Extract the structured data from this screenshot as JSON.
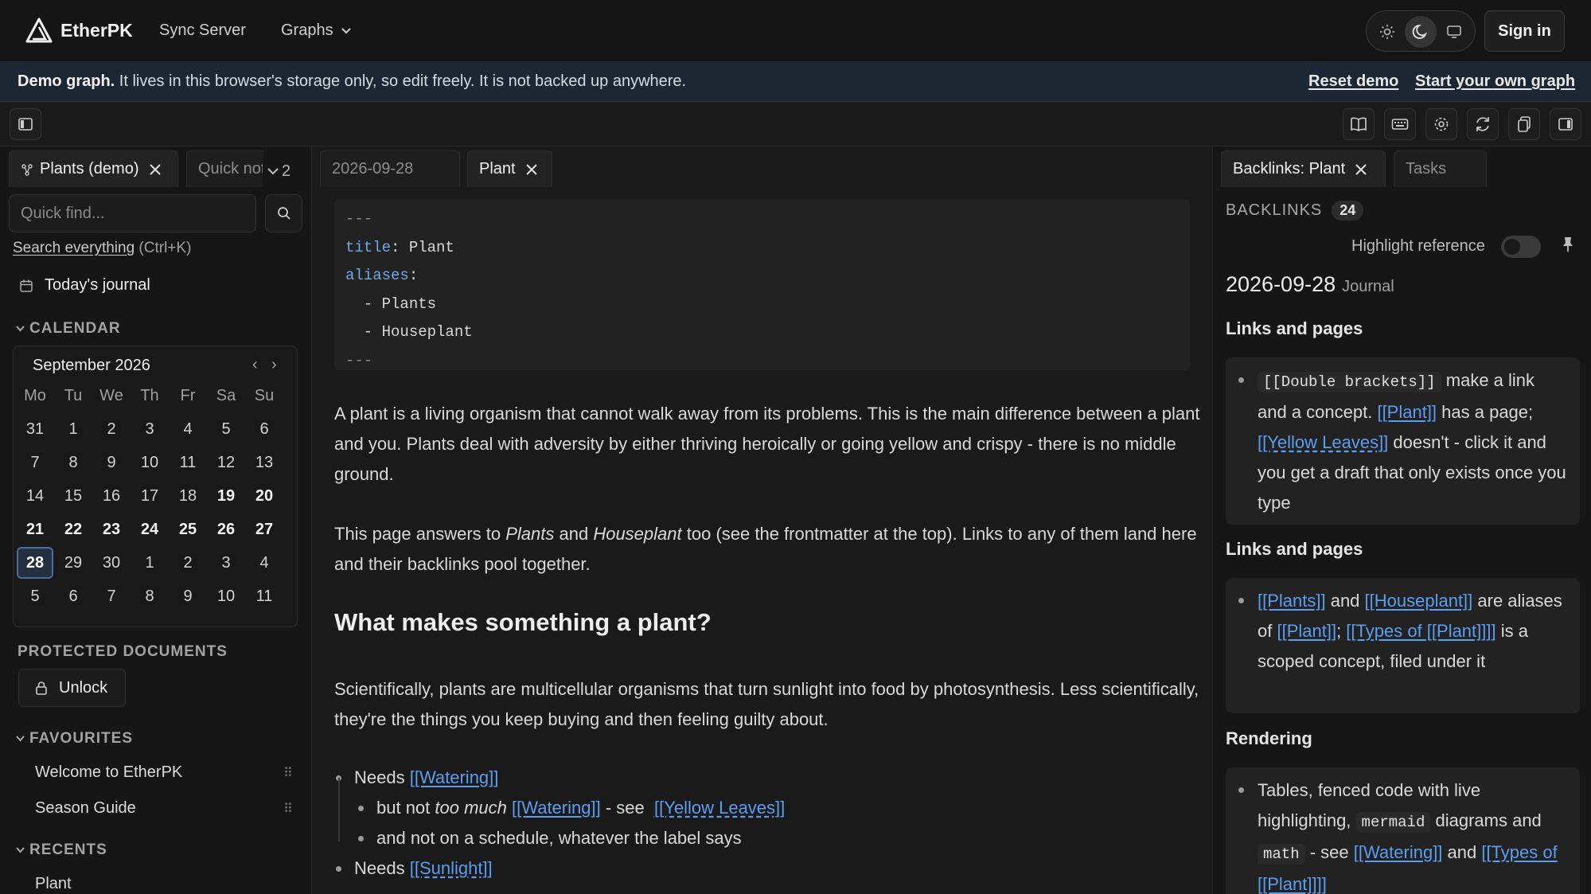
{
  "app": {
    "name": "EtherPK",
    "nav": {
      "sync": "Sync Server",
      "graphs": "Graphs"
    },
    "signin": "Sign in"
  },
  "banner": {
    "bold": "Demo graph.",
    "text": " It lives in this browser's storage only, so edit freely. It is not backed up anywhere.",
    "reset": "Reset demo",
    "start": "Start your own graph"
  },
  "left": {
    "tabs": {
      "plants": "Plants (demo)",
      "quick": "Quick notes",
      "more_count": "2"
    },
    "quickfind_placeholder": "Quick find...",
    "search_everything": "Search everything",
    "search_shortcut": " (Ctrl+K)",
    "todays_journal": "Today's journal",
    "calendar_label": "CALENDAR",
    "calendar": {
      "month": "September 2026",
      "weekdays": [
        "Mo",
        "Tu",
        "We",
        "Th",
        "Fr",
        "Sa",
        "Su"
      ],
      "weeks": [
        [
          "31",
          "1",
          "2",
          "3",
          "4",
          "5",
          "6"
        ],
        [
          "7",
          "8",
          "9",
          "10",
          "11",
          "12",
          "13"
        ],
        [
          "14",
          "15",
          "16",
          "17",
          "18",
          "19",
          "20"
        ],
        [
          "21",
          "22",
          "23",
          "24",
          "25",
          "26",
          "27"
        ],
        [
          "28",
          "29",
          "30",
          "1",
          "2",
          "3",
          "4"
        ],
        [
          "5",
          "6",
          "7",
          "8",
          "9",
          "10",
          "11"
        ]
      ],
      "today": "28"
    },
    "protected_label": "PROTECTED DOCUMENTS",
    "unlock": "Unlock",
    "favourites_label": "FAVOURITES",
    "favourites": [
      "Welcome to EtherPK",
      "Season Guide"
    ],
    "recents_label": "RECENTS",
    "recents": [
      "Plant"
    ]
  },
  "center": {
    "tabs": {
      "journal": "2026-09-28",
      "plant": "Plant"
    },
    "frontmatter": {
      "dash": "---",
      "title_key": "title",
      "title_val": "Plant",
      "aliases_key": "aliases",
      "aliases": [
        "Plants",
        "Houseplant"
      ]
    },
    "p1": "A plant is a living organism that cannot walk away from its problems. This is the main difference between a plant and you. Plants deal with adversity by either thriving heroically or going yellow and crispy - there is no middle ground.",
    "p2": {
      "a": "This page answers to ",
      "b": "Plants",
      "c": " and ",
      "d": "Houseplant",
      "e": " too (see the frontmatter at the top). Links to any of them land here and their backlinks pool together."
    },
    "heading": "What makes something a plant?",
    "p3": "Scientifically, plants are multicellular organisms that turn sunlight into food by photosynthesis. Less scientifically, they're the things you keep buying and then feeling guilty about.",
    "bullets": {
      "b1_pre": "Needs ",
      "b1_link": "[[Watering]]",
      "b2_pre": "but not ",
      "b2_em": "too much",
      "b2_link1": "[[Watering]]",
      "b2_mid": " - see ",
      "b2_link2": "[[Yellow Leaves]]",
      "b3": "and not on a schedule, whatever the label says",
      "b4_pre": "Needs ",
      "b4_link": "[[Sunlight]]"
    }
  },
  "right": {
    "tabs": {
      "backlinks": "Backlinks: Plant",
      "tasks": "Tasks"
    },
    "backlinks_label": "BACKLINKS",
    "backlinks_count": "24",
    "highlight_label": "Highlight reference",
    "date": "2026-09-28",
    "date_tag": "Journal",
    "sec1": "Links and pages",
    "card1": {
      "code": "[[Double brackets]]",
      "t1": " make a link and a concept. ",
      "l1": "[[Plant]]",
      "t2": " has a page; ",
      "l2": "[[Yellow Leaves]]",
      "t3": " doesn't - click it and you get a draft that only exists once you type"
    },
    "sec2": "Links and pages",
    "card2": {
      "l1": "[[Plants]]",
      "t1": " and ",
      "l2": "[[Houseplant]]",
      "t2": " are aliases of ",
      "l3": "[[Plant]]",
      "t3": "; ",
      "l4": "[[Types of [[Plant]]]]",
      "t4": " is a scoped concept, filed under it"
    },
    "sec3": "Rendering",
    "card3": {
      "t1": "Tables, fenced code with live highlighting, ",
      "c1": "mermaid",
      "t2": " diagrams and ",
      "c2": "math",
      "t3": " - see ",
      "l1": "[[Watering]]",
      "t4": " and ",
      "l2": "[[Types of [[Plant]]]]"
    }
  },
  "colors": {
    "link": "#5b9ef0",
    "today_border": "#4c6f99",
    "banner_bg": "#1d2733"
  }
}
